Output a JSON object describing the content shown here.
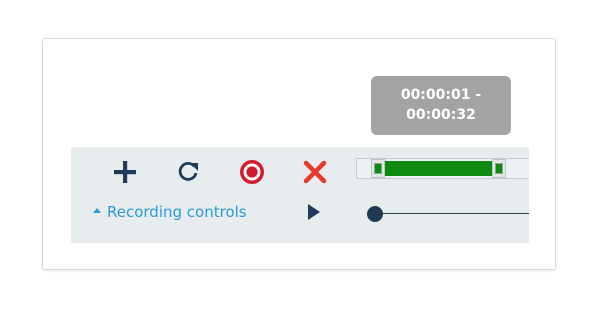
{
  "tooltip": {
    "line1": "00:00:01 -",
    "line2": "00:00:32"
  },
  "toolbar": {
    "icons": [
      "plus-icon",
      "redo-icon",
      "record-icon",
      "close-icon",
      "play-icon"
    ],
    "colors": {
      "icon_dark": "#1f3b57",
      "record_red": "#d01c2b",
      "delete_red": "#e8382e",
      "trim_green": "#0e8a12",
      "link_blue": "#2a9ad6",
      "panel_bg": "#e7ecef",
      "tooltip_bg": "#a3a3a3"
    }
  },
  "recording_controls": {
    "label": "Recording controls",
    "expanded": true
  },
  "trim": {
    "start_fraction": 0.07,
    "end_fraction": 0.68
  },
  "playback": {
    "position_fraction": 0.0
  }
}
